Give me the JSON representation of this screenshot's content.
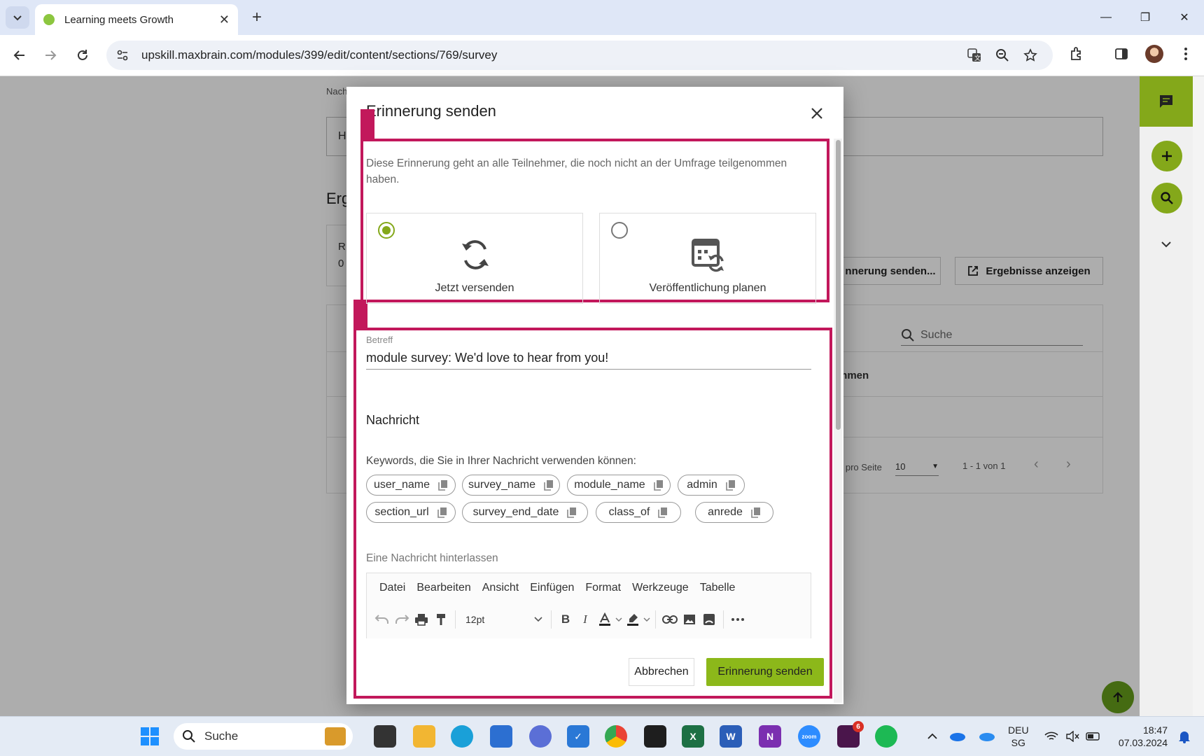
{
  "browser": {
    "tab_title": "Learning meets Growth",
    "url": "upskill.maxbrain.com/modules/399/edit/content/sections/769/survey"
  },
  "page": {
    "nach_label": "Nach",
    "input_value": "H",
    "section_heading": "Erg",
    "stat_label": "R",
    "stat_value": "0",
    "send_reminder_btn": "nnerung senden...",
    "show_results_btn": "Ergebnisse anzeigen",
    "search_placeholder": "Suche",
    "table_cell": "mmen",
    "per_page_label": "e pro Seite",
    "per_page_value": "10",
    "range_text": "1 - 1 von 1"
  },
  "modal": {
    "title": "Erinnerung senden",
    "intro": "Diese Erinnerung geht an alle Teilnehmer, die noch nicht an der Umfrage teilgenommen haben.",
    "options": [
      {
        "label": "Jetzt versenden",
        "selected": true,
        "icon": "sync-icon"
      },
      {
        "label": "Veröffentlichung planen",
        "selected": false,
        "icon": "schedule-icon"
      }
    ],
    "subject_label": "Betreff",
    "subject_value": "module survey: We'd love to hear from you!",
    "message_heading": "Nachricht",
    "keywords_intro": "Keywords, die Sie in Ihrer Nachricht verwenden können:",
    "keywords": [
      "user_name",
      "survey_name",
      "module_name",
      "admin",
      "section_url",
      "survey_end_date",
      "class_of",
      "anrede"
    ],
    "leave_message_label": "Eine Nachricht hinterlassen",
    "editor_menu": [
      "Datei",
      "Bearbeiten",
      "Ansicht",
      "Einfügen",
      "Format",
      "Werkzeuge",
      "Tabelle"
    ],
    "font_size": "12pt",
    "cancel_label": "Abbrechen",
    "send_label": "Erinnerung senden"
  },
  "taskbar": {
    "search_label": "Suche",
    "lang": "DEU",
    "region": "SG",
    "time": "18:47",
    "date": "07.03.2024",
    "slack_badge": "6"
  },
  "colors": {
    "accent": "#84a81a",
    "highlight": "#c2185b"
  }
}
